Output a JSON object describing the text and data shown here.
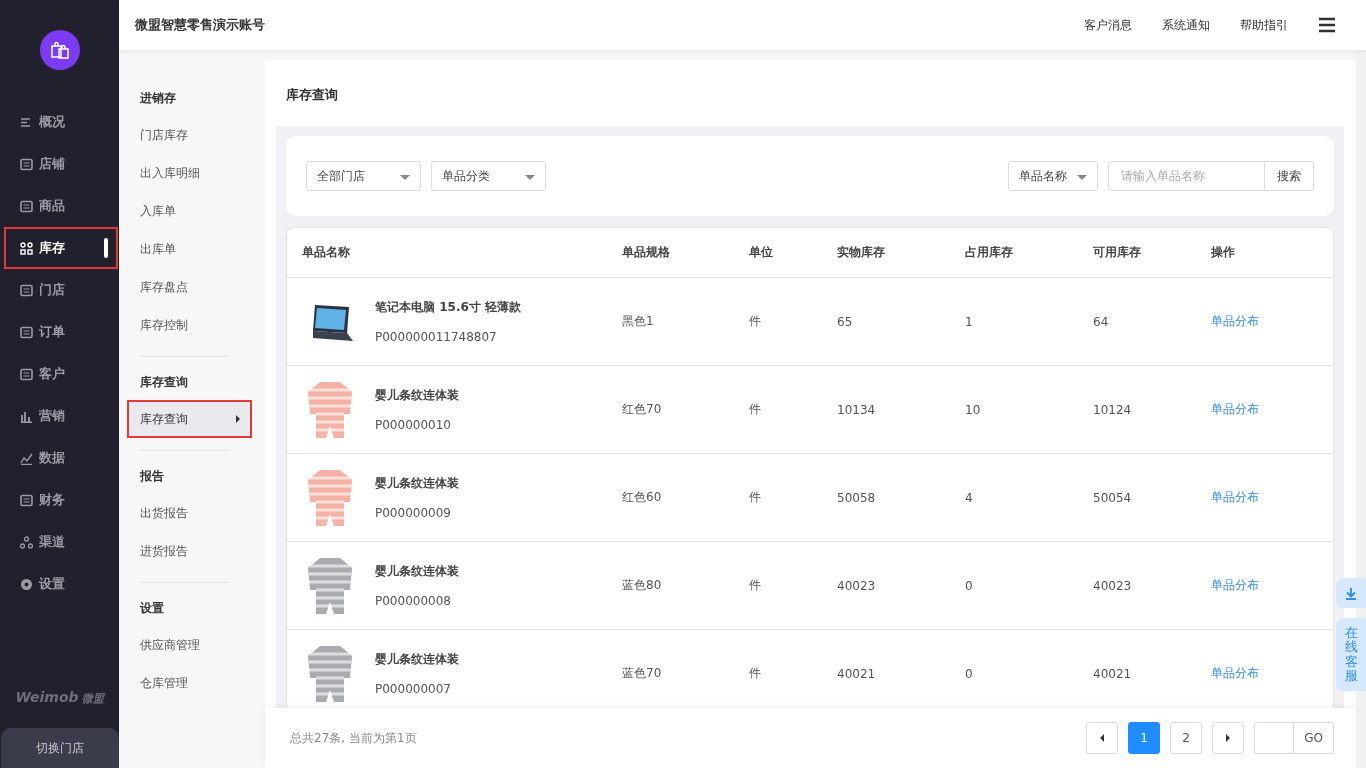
{
  "sidebar": {
    "brand": "Weimob",
    "brand_cn": "微盟",
    "switch_store": "切换门店",
    "items": [
      {
        "label": "概况",
        "selected": false
      },
      {
        "label": "店铺",
        "selected": false
      },
      {
        "label": "商品",
        "selected": false
      },
      {
        "label": "库存",
        "selected": true
      },
      {
        "label": "门店",
        "selected": false
      },
      {
        "label": "订单",
        "selected": false
      },
      {
        "label": "客户",
        "selected": false
      },
      {
        "label": "营销",
        "selected": false
      },
      {
        "label": "数据",
        "selected": false
      },
      {
        "label": "财务",
        "selected": false
      },
      {
        "label": "渠道",
        "selected": false
      },
      {
        "label": "设置",
        "selected": false
      }
    ]
  },
  "topbar": {
    "title": "微盟智慧零售演示账号",
    "links": [
      "客户消息",
      "系统通知",
      "帮助指引"
    ]
  },
  "subnav": [
    {
      "heading": "进销存",
      "items": [
        {
          "label": "门店库存",
          "selected": false
        },
        {
          "label": "出入库明细",
          "selected": false
        },
        {
          "label": "入库单",
          "selected": false
        },
        {
          "label": "出库单",
          "selected": false
        },
        {
          "label": "库存盘点",
          "selected": false
        },
        {
          "label": "库存控制",
          "selected": false
        }
      ]
    },
    {
      "heading": "库存查询",
      "items": [
        {
          "label": "库存查询",
          "selected": true
        }
      ]
    },
    {
      "heading": "报告",
      "items": [
        {
          "label": "出货报告",
          "selected": false
        },
        {
          "label": "进货报告",
          "selected": false
        }
      ]
    },
    {
      "heading": "设置",
      "items": [
        {
          "label": "供应商管理",
          "selected": false
        },
        {
          "label": "仓库管理",
          "selected": false
        }
      ]
    }
  ],
  "page": {
    "title": "库存查询",
    "filters": {
      "store": "全部门店",
      "category": "单品分类",
      "search_by": "单品名称",
      "search": {
        "placeholder": "请输入单品名称"
      },
      "search_button": "搜索"
    },
    "table": {
      "columns": [
        "单品名称",
        "单品规格",
        "单位",
        "实物库存",
        "占用库存",
        "可用库存",
        "操作"
      ],
      "rows": [
        {
          "thumb": {
            "kind": "laptop"
          },
          "name": "笔记本电脑 15.6寸 轻薄款",
          "code": "P000000011748807",
          "spec": "黑色1",
          "unit": "件",
          "physical": "65",
          "occupied": "1",
          "available": "64",
          "action": "单品分布"
        },
        {
          "thumb": {
            "kind": "onesie",
            "color": "#f4b2a6"
          },
          "name": "婴儿条纹连体装",
          "code": "P000000010",
          "spec": "红色70",
          "unit": "件",
          "physical": "10134",
          "occupied": "10",
          "available": "10124",
          "action": "单品分布"
        },
        {
          "thumb": {
            "kind": "onesie",
            "color": "#f4b2a6"
          },
          "name": "婴儿条纹连体装",
          "code": "P000000009",
          "spec": "红色60",
          "unit": "件",
          "physical": "50058",
          "occupied": "4",
          "available": "50054",
          "action": "单品分布"
        },
        {
          "thumb": {
            "kind": "onesie",
            "color": "#a9abb0"
          },
          "name": "婴儿条纹连体装",
          "code": "P000000008",
          "spec": "蓝色80",
          "unit": "件",
          "physical": "40023",
          "occupied": "0",
          "available": "40023",
          "action": "单品分布"
        },
        {
          "thumb": {
            "kind": "onesie",
            "color": "#a9abb0"
          },
          "name": "婴儿条纹连体装",
          "code": "P000000007",
          "spec": "蓝色70",
          "unit": "件",
          "physical": "40021",
          "occupied": "0",
          "available": "40021",
          "action": "单品分布"
        }
      ]
    },
    "footer": {
      "summary": "总共27条, 当前为第1页",
      "pages": [
        {
          "label": "1",
          "selected": true
        },
        {
          "label": "2",
          "selected": false
        }
      ],
      "go": "GO"
    }
  },
  "service": {
    "label": "在线客服"
  }
}
